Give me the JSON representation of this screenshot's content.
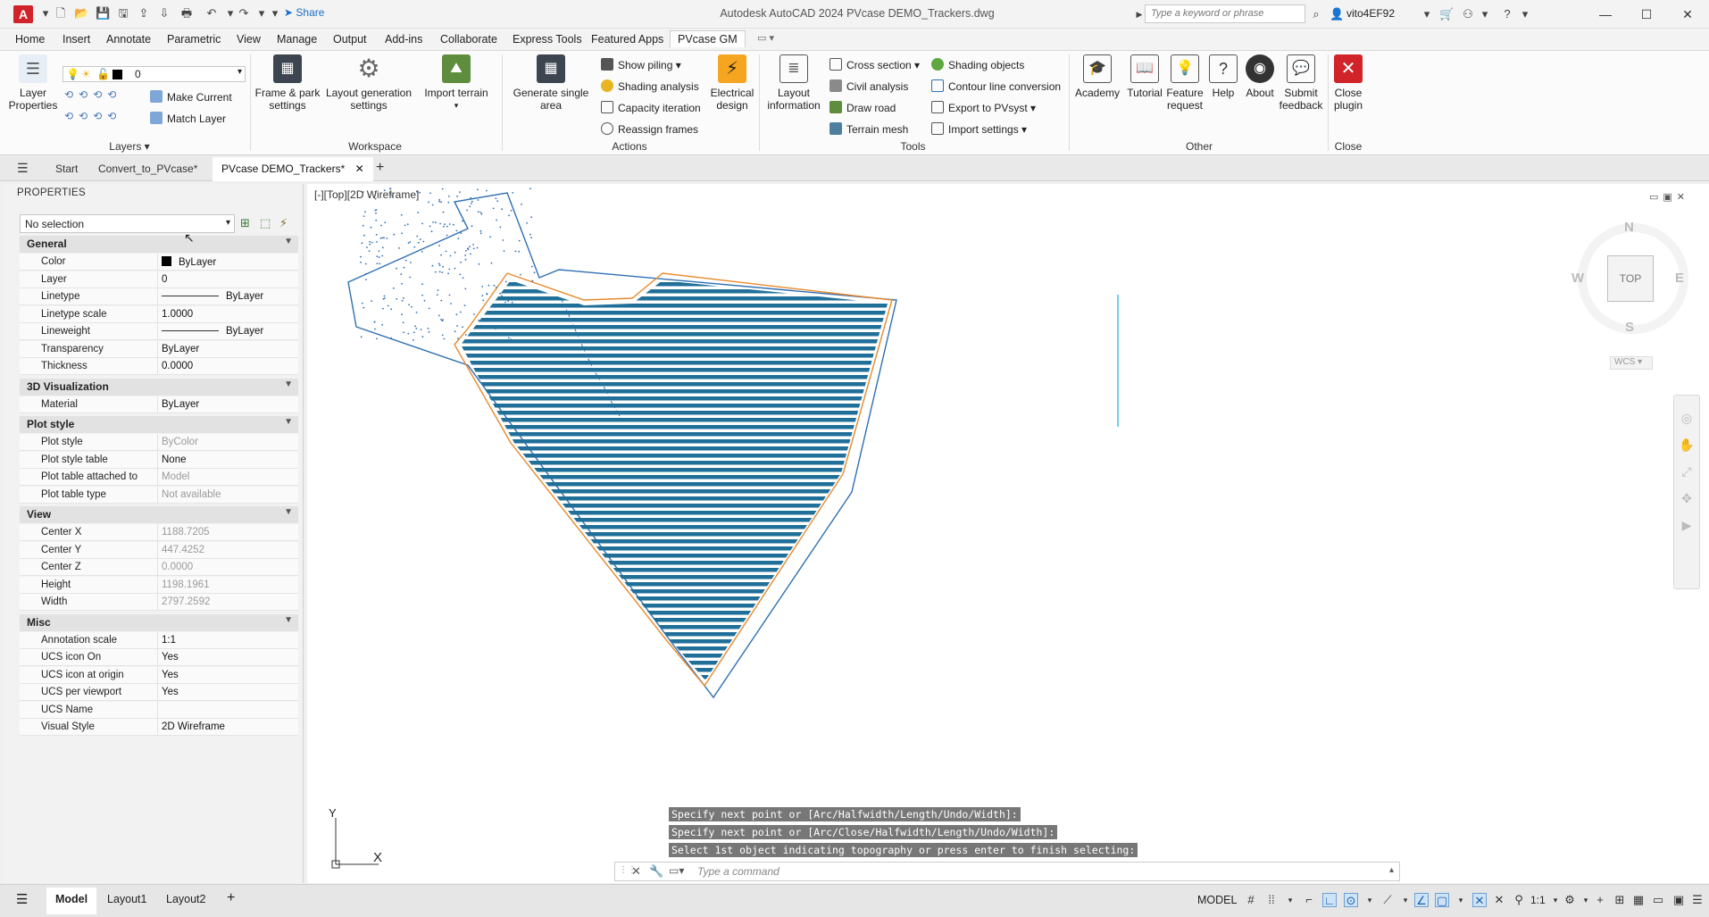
{
  "titlebar": {
    "app_icon": "A",
    "share_label": "Share",
    "window_title": "Autodesk AutoCAD 2024    PVcase DEMO_Trackers.dwg",
    "search_placeholder": "Type a keyword or phrase",
    "user_name": "vito4EF92"
  },
  "menu_tabs": [
    "Home",
    "Insert",
    "Annotate",
    "Parametric",
    "View",
    "Manage",
    "Output",
    "Add-ins",
    "Collaborate",
    "Express Tools",
    "Featured Apps",
    "PVcase GM"
  ],
  "active_menu_tab": "PVcase GM",
  "ribbon": {
    "layers": {
      "layer_properties": "Layer\nProperties",
      "layer_combo_value": "0",
      "make_current": "Make Current",
      "match_layer": "Match Layer",
      "panel_title": "Layers"
    },
    "workspace": {
      "frame_park": "Frame & park\nsettings",
      "layout_generation": "Layout generation\nsettings",
      "import_terrain": "Import terrain",
      "panel_title": "Workspace"
    },
    "actions": {
      "generate_single_area": "Generate single\narea",
      "show_piling": "Show piling",
      "shading_analysis": "Shading analysis",
      "capacity_iteration": "Capacity iteration",
      "reassign_frames": "Reassign frames",
      "electrical_design": "Electrical\ndesign",
      "panel_title": "Actions"
    },
    "tools": {
      "layout_information": "Layout\ninformation",
      "cross_section": "Cross section",
      "civil_analysis": "Civil analysis",
      "draw_road": "Draw road",
      "terrain_mesh": "Terrain mesh",
      "shading_objects": "Shading objects",
      "contour_line_conversion": "Contour line conversion",
      "export_pvsyst": "Export to PVsyst",
      "import_settings": "Import settings",
      "panel_title": "Tools"
    },
    "other": {
      "academy": "Academy",
      "tutorial": "Tutorial",
      "feature_request": "Feature\nrequest",
      "help": "Help",
      "about": "About",
      "submit_feedback": "Submit\nfeedback",
      "panel_title": "Other"
    },
    "close": {
      "close_plugin": "Close\nplugin",
      "panel_title": "Close"
    }
  },
  "doc_tabs": [
    "Start",
    "Convert_to_PVcase*",
    "PVcase DEMO_Trackers*"
  ],
  "properties": {
    "title": "PROPERTIES",
    "selection": "No selection",
    "sections": [
      {
        "name": "General",
        "rows": [
          {
            "k": "Color",
            "v": "ByLayer"
          },
          {
            "k": "Layer",
            "v": "0"
          },
          {
            "k": "Linetype",
            "v": "ByLayer"
          },
          {
            "k": "Linetype scale",
            "v": "1.0000"
          },
          {
            "k": "Lineweight",
            "v": "ByLayer"
          },
          {
            "k": "Transparency",
            "v": "ByLayer"
          },
          {
            "k": "Thickness",
            "v": "0.0000"
          }
        ]
      },
      {
        "name": "3D Visualization",
        "rows": [
          {
            "k": "Material",
            "v": "ByLayer"
          }
        ]
      },
      {
        "name": "Plot style",
        "rows": [
          {
            "k": "Plot style",
            "v": "ByColor"
          },
          {
            "k": "Plot style table",
            "v": "None"
          },
          {
            "k": "Plot table attached to",
            "v": "Model"
          },
          {
            "k": "Plot table type",
            "v": "Not available"
          }
        ]
      },
      {
        "name": "View",
        "rows": [
          {
            "k": "Center X",
            "v": "1188.7205"
          },
          {
            "k": "Center Y",
            "v": "447.4252"
          },
          {
            "k": "Center Z",
            "v": "0.0000"
          },
          {
            "k": "Height",
            "v": "1198.1961"
          },
          {
            "k": "Width",
            "v": "2797.2592"
          }
        ]
      },
      {
        "name": "Misc",
        "rows": [
          {
            "k": "Annotation scale",
            "v": "1:1"
          },
          {
            "k": "UCS icon On",
            "v": "Yes"
          },
          {
            "k": "UCS icon at origin",
            "v": "Yes"
          },
          {
            "k": "UCS per viewport",
            "v": "Yes"
          },
          {
            "k": "UCS Name",
            "v": ""
          },
          {
            "k": "Visual Style",
            "v": "2D Wireframe"
          }
        ]
      }
    ]
  },
  "viewport": {
    "label": "[-][Top][2D Wireframe]",
    "viewcube": {
      "n": "N",
      "s": "S",
      "e": "E",
      "w": "W",
      "face": "TOP",
      "wcs": "WCS"
    },
    "ucs_x": "X",
    "ucs_y": "Y"
  },
  "command": {
    "history": [
      "Specify next point or [Arc/Halfwidth/Length/Undo/Width]:",
      "Specify next point or [Arc/Close/Halfwidth/Length/Undo/Width]:",
      "Select 1st object indicating topography or press enter to finish selecting:"
    ],
    "placeholder": "Type a command"
  },
  "statusbar": {
    "layouts": [
      "Model",
      "Layout1",
      "Layout2"
    ],
    "model_label": "MODEL",
    "scale": "1:1"
  },
  "colors": {
    "tracker_blue": "#1f6f99",
    "boundary_orange": "#e8892a",
    "outline_blue": "#2f6fb3",
    "accent": "#1a6fc9",
    "close_red": "#d1232a"
  }
}
